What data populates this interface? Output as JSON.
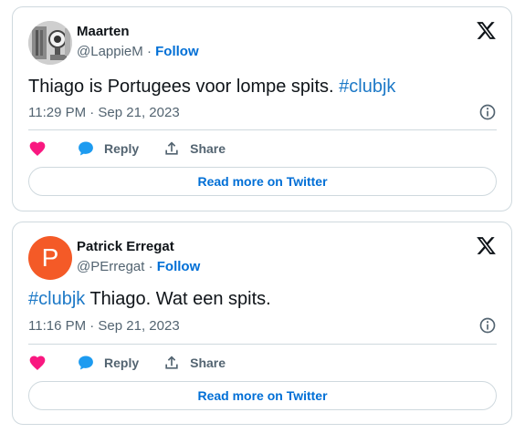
{
  "tweets": [
    {
      "author_name": "Maarten",
      "handle": "@LappieM",
      "separator": "·",
      "follow_label": "Follow",
      "text_plain": "Thiago is Portugees voor lompe spits. ",
      "hashtag": "#clubjk",
      "timestamp": "11:29 PM · Sep 21, 2023",
      "reply_label": "Reply",
      "share_label": "Share",
      "read_more_label": "Read more on Twitter",
      "avatar_icon": "avatar-photo"
    },
    {
      "author_name": "Patrick Erregat",
      "handle": "@PErregat",
      "separator": "·",
      "follow_label": "Follow",
      "avatar_letter": "P",
      "hashtag": "#clubjk",
      "text_plain": " Thiago. Wat een spits.",
      "timestamp": "11:16 PM · Sep 21, 2023",
      "reply_label": "Reply",
      "share_label": "Share",
      "read_more_label": "Read more on Twitter"
    }
  ],
  "colors": {
    "link": "#006fd6",
    "hashtag": "#1d79c7",
    "heart": "#f91880",
    "reply_bubble": "#1d9bf0",
    "avatar_letter_bg": "#f45a27"
  },
  "icons": [
    "x-logo-icon",
    "info-icon",
    "heart-icon",
    "reply-bubble-icon",
    "share-icon"
  ]
}
